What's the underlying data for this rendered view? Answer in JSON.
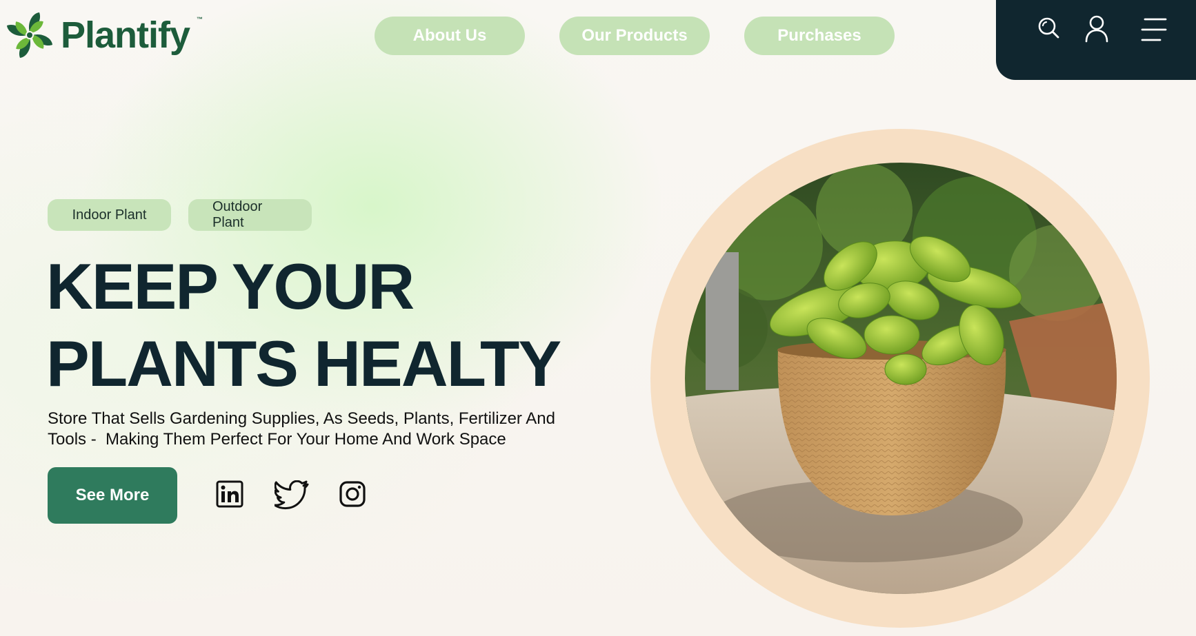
{
  "brand": {
    "name": "Plantify",
    "trademark": "™",
    "logo_icon": "pinwheel-leaf-icon"
  },
  "nav": {
    "items": [
      {
        "label": "About Us"
      },
      {
        "label": "Our Products"
      },
      {
        "label": "Purchases"
      }
    ]
  },
  "top_actions": {
    "icons": [
      "search-icon",
      "user-icon",
      "menu-icon"
    ]
  },
  "hero": {
    "tags": [
      "Indoor Plant",
      "Outdoor Plant"
    ],
    "title_line1": "KEEP YOUR",
    "title_line2": "PLANTS HEALTY",
    "description_line1": "Store That Sells Gardening Supplies, As Seeds, Plants, Fertilizer And",
    "description_line2": "Tools -  Making Them Perfect For Your Home And Work Space",
    "cta_label": "See More",
    "social_icons": [
      "linkedin-icon",
      "twitter-icon",
      "instagram-icon"
    ]
  },
  "colors": {
    "brand_green": "#1d5c3b",
    "nav_pill": "#c5e2b6",
    "dark_panel": "#10262f",
    "cta": "#2f7b5d",
    "ring": "#f7dfc4"
  }
}
